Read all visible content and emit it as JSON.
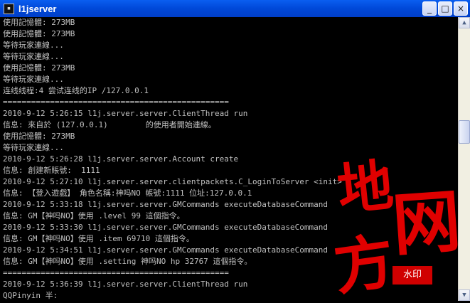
{
  "window": {
    "title": "l1jserver"
  },
  "title_buttons": {
    "minimize": "_",
    "maximize": "□",
    "close": "×"
  },
  "console": {
    "lines": [
      "使用記憶體: 273MB",
      "使用記憶體: 273MB",
      "等待玩家連線...",
      "等待玩家連線...",
      "使用記憶體: 273MB",
      "等待玩家連線...",
      "连线线程:4 尝试连线的IP /127.0.0.1",
      "================================================",
      "2010-9-12 5:26:15 l1j.server.server.ClientThread run",
      "信息: 來自於 (127.0.0.1)        的使用者開始連線。",
      "使用記憶體: 273MB",
      "等待玩家連線...",
      "2010-9-12 5:26:28 l1j.server.server.Account create",
      "信息: 創建新賬號:  1111",
      "2010-9-12 5:27:10 l1j.server.server.clientpackets.C_LoginToServer <init>",
      "信息: 【登入遊戲】 角色名稱:神吗NO 帳號:1111 位址:127.0.0.1",
      "2010-9-12 5:33:18 l1j.server.server.GMCommands executeDatabaseCommand",
      "信息: GM【神吗NO】使用 .level 99 這個指令。",
      "2010-9-12 5:33:30 l1j.server.server.GMCommands executeDatabaseCommand",
      "信息: GM【神吗NO】使用 .item 69710 這個指令。",
      "2010-9-12 5:34:51 l1j.server.server.GMCommands executeDatabaseCommand",
      "信息: GM【神吗NO】使用 .setting 神吗NO hp 32767 這個指令。",
      "================================================",
      "2010-9-12 5:36:39 l1j.server.server.ClientThread run",
      "QQPinyin 半:"
    ]
  },
  "watermark": {
    "chars": [
      "地",
      "网",
      "方"
    ],
    "seal": "水印",
    "color": "#e00000"
  }
}
